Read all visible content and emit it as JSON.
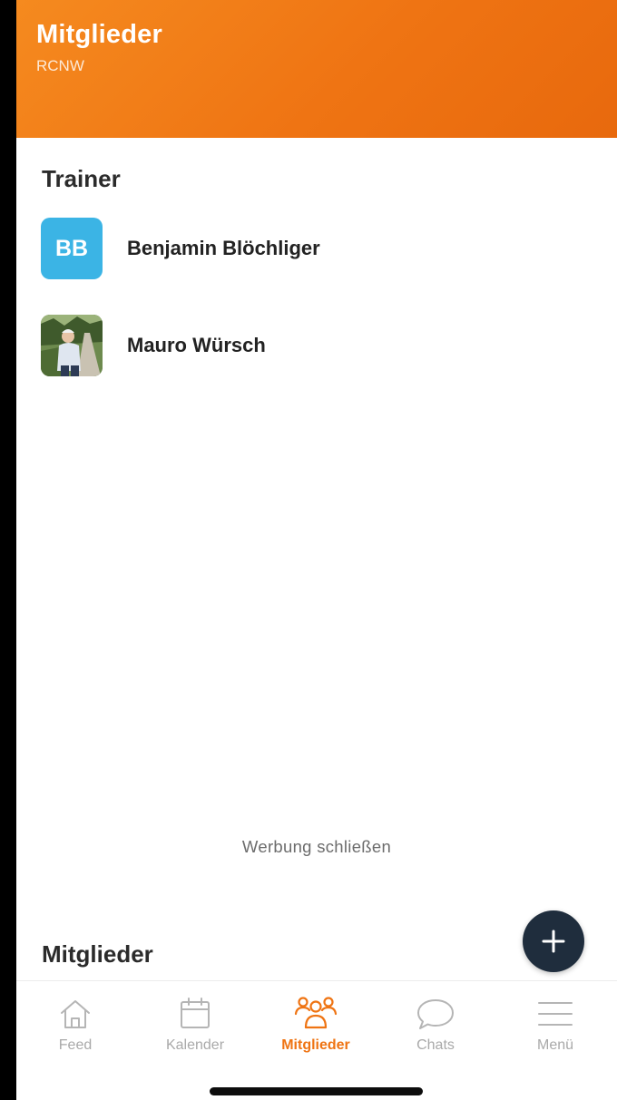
{
  "header": {
    "title": "Mitglieder",
    "subtitle": "RCNW",
    "background_color": "#ef7413"
  },
  "sections": {
    "trainer_title": "Trainer",
    "members_title": "Mitglieder"
  },
  "trainers": [
    {
      "initials": "BB",
      "name": "Benjamin Blöchliger",
      "avatar_color": "#3bb4e5"
    },
    {
      "name": "Mauro Würsch",
      "avatar": "photo"
    }
  ],
  "ad": {
    "close_label": "Werbung schließen"
  },
  "fab": {
    "icon": "plus-icon",
    "color": "#1f2d3d"
  },
  "tabbar": {
    "active_color": "#ef7413",
    "inactive_color": "#a9a9a9",
    "items": [
      {
        "label": "Feed",
        "icon": "home-icon"
      },
      {
        "label": "Kalender",
        "icon": "calendar-icon"
      },
      {
        "label": "Mitglieder",
        "icon": "members-icon",
        "active": true
      },
      {
        "label": "Chats",
        "icon": "chat-bubble-icon"
      },
      {
        "label": "Menü",
        "icon": "hamburger-menu-icon"
      }
    ]
  }
}
